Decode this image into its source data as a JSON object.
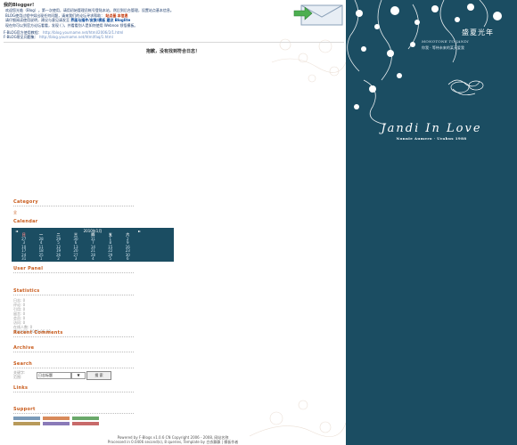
{
  "welcome": {
    "title": "我的Blogger!",
    "para1": "欢迎您光临（Blog）。第一次使用，请用初始管理员帐号登陆本站，然后到后台管理，设置站点基本信息。",
    "para2": "BLOG使用过程中如出现任何问题，请来我们的论坛寻求帮助：",
    "para3": "请仔细阅读使用说明，建议与意见请发至",
    "highlight1": "站点基",
    "highlight2": "本信息",
    "bold1": "界面与插件/皮肤/模板",
    "bold2": "建议",
    "bold3": "Bloglite",
    "para4": "现在你可以到官方论坛看看，发现 ( )，并看看别人是如何使用 Webnoo 领悟模板。",
    "link1_label": "F-BLOG官方使用教程：",
    "link1_url": "http://blog.yourname.net/html/2006/2/1.html",
    "link2_label": "F-BLOG常见问题集：",
    "link2_url": "http://blog.yourname.net/html/faq/1.html"
  },
  "note": "抱歉，没有找到符合日志！",
  "sections": {
    "category": "Category",
    "calendar": "Calendar",
    "user_panel": "User Panel",
    "statistics": "Statistics",
    "recent_comments": "Recent Comments",
    "archive": "Archive",
    "search": "Search",
    "links": "Links",
    "support": "Support"
  },
  "category_item": "全",
  "calendar": {
    "month": "2010年1月",
    "prev": "◄",
    "next": "►",
    "weekdays": [
      "日",
      "一",
      "二",
      "三",
      "四",
      "五",
      "六"
    ],
    "rows": [
      [
        "27",
        "28",
        "29",
        "30",
        "31",
        "1",
        "2"
      ],
      [
        "3",
        "4",
        "5",
        "6",
        "7",
        "8",
        "9"
      ],
      [
        "10",
        "11",
        "12",
        "13",
        "14",
        "15",
        "16"
      ],
      [
        "17",
        "18",
        "19",
        "20",
        "21",
        "22",
        "23"
      ],
      [
        "24",
        "25",
        "26",
        "27",
        "28",
        "29",
        "30"
      ],
      [
        "31",
        "1",
        "2",
        "3",
        "4",
        "5",
        "6"
      ]
    ]
  },
  "statistics": [
    "日志: 0",
    "评论: 0",
    "引用: 0",
    "留言: 0",
    "会员: 0",
    "访问: 0",
    "在线人数: 0",
    "建站时间: 2008-06-09"
  ],
  "search": {
    "label1": "关键字:",
    "label2": "范围:",
    "input_value": "日志标题",
    "select_value": "▼",
    "button_label": "搜 索"
  },
  "footer": {
    "line1": "Powered by F-Blogs v1.0.6 CN Copyright 2006 - 2008, 网站名称",
    "line2": "Processed in 0.0406 second(s), 8 queries, Template by 白衣飘飘 | 模板作者"
  },
  "side": {
    "title": "Jandi  In  Love",
    "subtitle": "Nonnie Aumero · Urahus 1988",
    "mono": "MONOTONE TO JANDI",
    "cn_sub": "你我 · 等待未来的某天爱我",
    "cn_title": "盛夏光年"
  },
  "colors": {
    "sidebar_bg": "#1b4d62",
    "section_title": "#c85a1a",
    "link": "#6b8dc1"
  }
}
